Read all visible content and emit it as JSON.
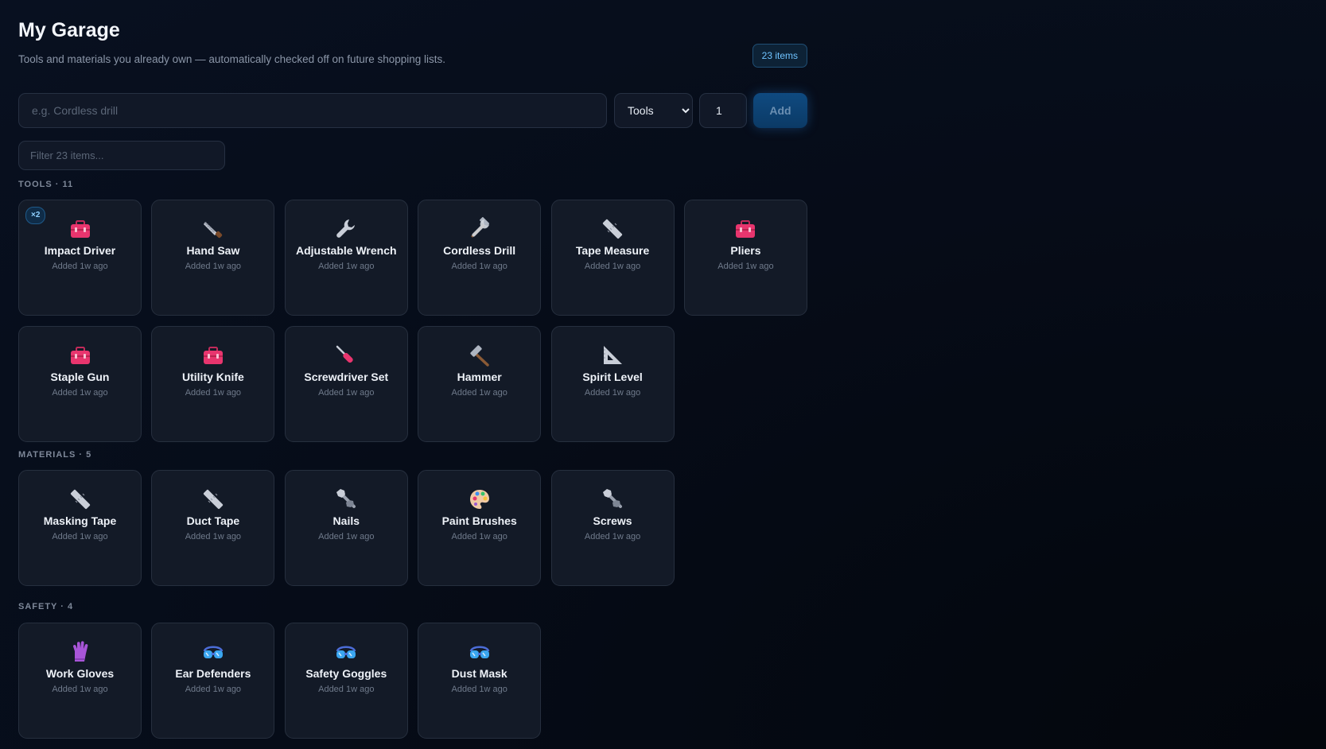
{
  "header": {
    "title": "My Garage",
    "subtitle": "Tools and materials you already own — automatically checked off on future shopping lists.",
    "count_badge": "23 items"
  },
  "add_form": {
    "name_placeholder": "e.g. Cordless drill",
    "category_selected": "Tools",
    "quantity_value": "1",
    "add_label": "Add"
  },
  "filter": {
    "placeholder": "Filter 23 items..."
  },
  "sections": [
    {
      "label": "TOOLS · 11",
      "items": [
        {
          "name": "Impact Driver",
          "added": "Added 1w ago",
          "icon": "toolbox-icon",
          "qty_badge": "×2"
        },
        {
          "name": "Hand Saw",
          "added": "Added 1w ago",
          "icon": "saw-icon"
        },
        {
          "name": "Adjustable Wrench",
          "added": "Added 1w ago",
          "icon": "wrench-icon"
        },
        {
          "name": "Cordless Drill",
          "added": "Added 1w ago",
          "icon": "hammer-and-wrench-icon"
        },
        {
          "name": "Tape Measure",
          "added": "Added 1w ago",
          "icon": "ruler-icon"
        },
        {
          "name": "Pliers",
          "added": "Added 1w ago",
          "icon": "toolbox-icon"
        },
        {
          "name": "Staple Gun",
          "added": "Added 1w ago",
          "icon": "toolbox-icon"
        },
        {
          "name": "Utility Knife",
          "added": "Added 1w ago",
          "icon": "toolbox-icon"
        },
        {
          "name": "Screwdriver Set",
          "added": "Added 1w ago",
          "icon": "screwdriver-icon"
        },
        {
          "name": "Hammer",
          "added": "Added 1w ago",
          "icon": "hammer-icon"
        },
        {
          "name": "Spirit Level",
          "added": "Added 1w ago",
          "icon": "triangular-ruler-icon"
        }
      ]
    },
    {
      "label": "MATERIALS · 5",
      "items": [
        {
          "name": "Masking Tape",
          "added": "Added 1w ago",
          "icon": "ruler-icon"
        },
        {
          "name": "Duct Tape",
          "added": "Added 1w ago",
          "icon": "ruler-icon"
        },
        {
          "name": "Nails",
          "added": "Added 1w ago",
          "icon": "nut-and-bolt-icon"
        },
        {
          "name": "Paint Brushes",
          "added": "Added 1w ago",
          "icon": "palette-icon"
        },
        {
          "name": "Screws",
          "added": "Added 1w ago",
          "icon": "nut-and-bolt-icon"
        }
      ]
    },
    {
      "label": "SAFETY · 4",
      "items": [
        {
          "name": "Work Gloves",
          "added": "Added 1w ago",
          "icon": "gloves-icon"
        },
        {
          "name": "Ear Defenders",
          "added": "Added 1w ago",
          "icon": "goggles-icon"
        },
        {
          "name": "Safety Goggles",
          "added": "Added 1w ago",
          "icon": "goggles-icon"
        },
        {
          "name": "Dust Mask",
          "added": "Added 1w ago",
          "icon": "goggles-icon"
        }
      ]
    }
  ],
  "colors": {
    "background": "#070d1a",
    "card": "#131a27",
    "accent": "#6fc3ff",
    "toolbox": "#e8356e"
  }
}
